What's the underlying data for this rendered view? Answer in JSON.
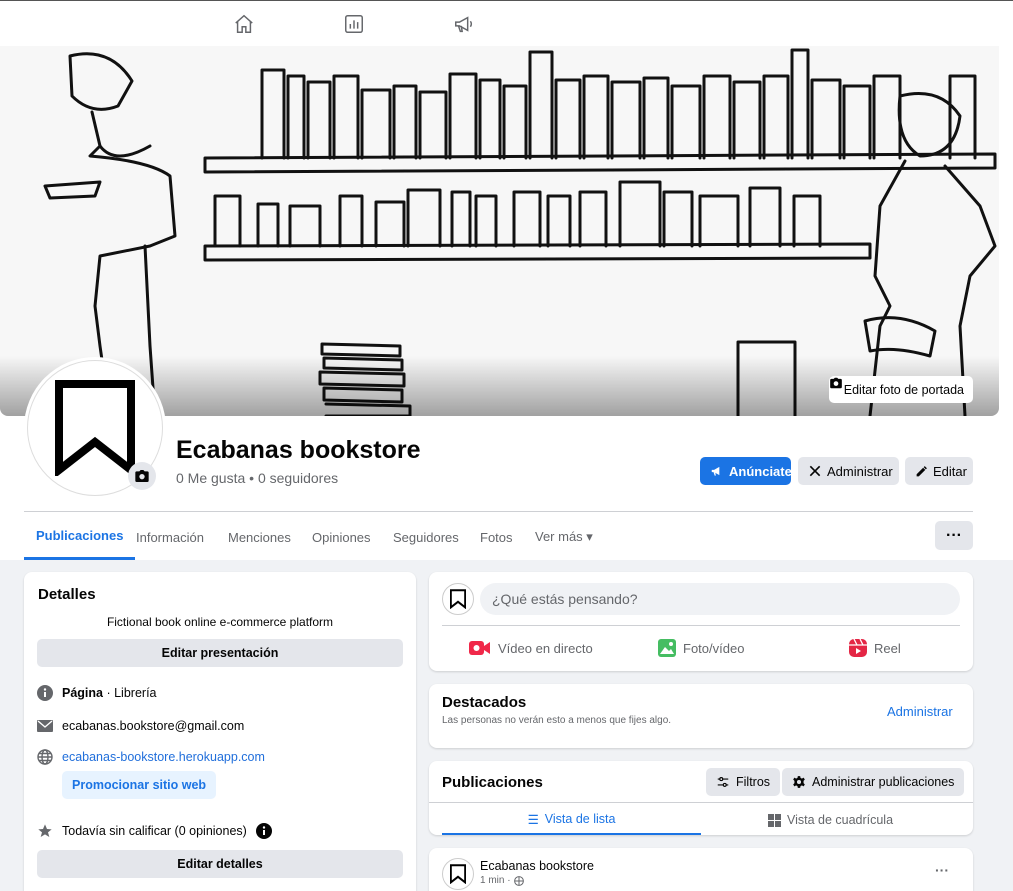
{
  "topnav": {
    "icons": [
      "home-icon",
      "insights-icon",
      "megaphone-icon"
    ]
  },
  "cover": {
    "edit_cover_label": "Editar foto de portada"
  },
  "profile": {
    "name": "Ecabanas bookstore",
    "stats": "0 Me gusta • 0 seguidores",
    "buttons": {
      "advertise": "Anúnciate",
      "manage": "Administrar",
      "edit": "Editar"
    }
  },
  "tabs": [
    {
      "label": "Publicaciones",
      "active": true
    },
    {
      "label": "Información"
    },
    {
      "label": "Menciones"
    },
    {
      "label": "Opiniones"
    },
    {
      "label": "Seguidores"
    },
    {
      "label": "Fotos"
    },
    {
      "label": "Ver más ▾"
    }
  ],
  "more_label": "···",
  "details": {
    "title": "Detalles",
    "bio": "Fictional book online e-commerce platform",
    "edit_intro": "Editar presentación",
    "page_type_bold": "Página",
    "page_type_rest": " · Librería",
    "email": "ecabanas.bookstore@gmail.com",
    "website": "ecabanas-bookstore.herokuapp.com",
    "promote": "Promocionar sitio web",
    "rating": "Todavía sin calificar (0 opiniones)",
    "edit_details": "Editar detalles"
  },
  "composer": {
    "placeholder": "¿Qué estás pensando?",
    "actions": {
      "live": "Vídeo en directo",
      "photo": "Foto/vídeo",
      "reel": "Reel"
    }
  },
  "featured": {
    "title": "Destacados",
    "subtitle": "Las personas no verán esto a menos que fijes algo.",
    "manage": "Administrar"
  },
  "posts": {
    "title": "Publicaciones",
    "filters": "Filtros",
    "manage_posts": "Administrar publicaciones",
    "list_view": "Vista de lista",
    "grid_view": "Vista de cuadrícula"
  },
  "post": {
    "author": "Ecabanas bookstore",
    "time": "1 min ·",
    "more": "···"
  },
  "colors": {
    "accent": "#1b74e4",
    "link": "#216fdb",
    "background": "#f0f2f5",
    "button_gray": "#e4e6eb"
  }
}
